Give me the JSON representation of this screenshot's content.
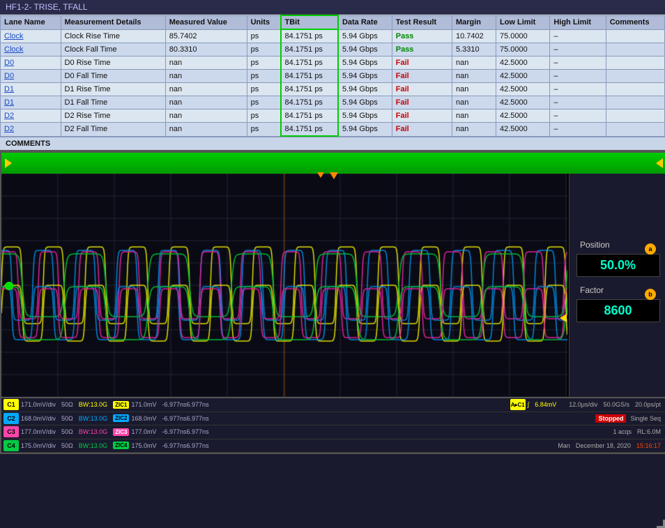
{
  "title": "HF1-2- TRISE, TFALL",
  "table": {
    "headers": [
      "Lane Name",
      "Measurement Details",
      "Measured Value",
      "Units",
      "TBit",
      "Data Rate",
      "Test Result",
      "Margin",
      "Low Limit",
      "High Limit",
      "Comments"
    ],
    "rows": [
      {
        "lane": "Clock",
        "measurement": "Clock Rise Time",
        "value": "85.7402",
        "units": "ps",
        "tbit": "84.1751 ps",
        "datarate": "5.94 Gbps",
        "result": "Pass",
        "margin": "10.7402",
        "low": "75.0000",
        "high": "–",
        "comments": ""
      },
      {
        "lane": "Clock",
        "measurement": "Clock Fall Time",
        "value": "80.3310",
        "units": "ps",
        "tbit": "84.1751 ps",
        "datarate": "5.94 Gbps",
        "result": "Pass",
        "margin": "5.3310",
        "low": "75.0000",
        "high": "–",
        "comments": ""
      },
      {
        "lane": "D0",
        "measurement": "D0 Rise Time",
        "value": "nan",
        "units": "ps",
        "tbit": "84.1751 ps",
        "datarate": "5.94 Gbps",
        "result": "Fail",
        "margin": "nan",
        "low": "42.5000",
        "high": "–",
        "comments": ""
      },
      {
        "lane": "D0",
        "measurement": "D0 Fall Time",
        "value": "nan",
        "units": "ps",
        "tbit": "84.1751 ps",
        "datarate": "5.94 Gbps",
        "result": "Fail",
        "margin": "nan",
        "low": "42.5000",
        "high": "–",
        "comments": ""
      },
      {
        "lane": "D1",
        "measurement": "D1 Rise Time",
        "value": "nan",
        "units": "ps",
        "tbit": "84.1751 ps",
        "datarate": "5.94 Gbps",
        "result": "Fail",
        "margin": "nan",
        "low": "42.5000",
        "high": "–",
        "comments": ""
      },
      {
        "lane": "D1",
        "measurement": "D1 Fall Time",
        "value": "nan",
        "units": "ps",
        "tbit": "84.1751 ps",
        "datarate": "5.94 Gbps",
        "result": "Fail",
        "margin": "nan",
        "low": "42.5000",
        "high": "–",
        "comments": ""
      },
      {
        "lane": "D2",
        "measurement": "D2 Rise Time",
        "value": "nan",
        "units": "ps",
        "tbit": "84.1751 ps",
        "datarate": "5.94 Gbps",
        "result": "Fail",
        "margin": "nan",
        "low": "42.5000",
        "high": "–",
        "comments": ""
      },
      {
        "lane": "D2",
        "measurement": "D2 Fall Time",
        "value": "nan",
        "units": "ps",
        "tbit": "84.1751 ps",
        "datarate": "5.94 Gbps",
        "result": "Fail",
        "margin": "nan",
        "low": "42.5000",
        "high": "–",
        "comments": ""
      }
    ]
  },
  "comments_label": "COMMENTS",
  "scope": {
    "position_label": "Position",
    "position_value": "50.0%",
    "factor_label": "Factor",
    "factor_value": "8600",
    "badge_a": "a",
    "badge_b": "b",
    "ch1": {
      "color": "#ffff00",
      "label": "C1",
      "vdiv": "171.0mV/div",
      "ohm": "50Ω",
      "bw": "BW:13.0G",
      "zic": "ZIC1",
      "zic_val": "171.0mV",
      "time": "-6.977ns6.977ns"
    },
    "ch2": {
      "color": "#00aaff",
      "label": "C2",
      "vdiv": "168.0mV/div",
      "ohm": "50Ω",
      "bw": "BW:13.0G",
      "zic": "ZIC2",
      "zic_val": "168.0mV",
      "time": "-6.977ns6.977ns"
    },
    "ch3": {
      "color": "#ff44aa",
      "label": "C3",
      "vdiv": "177.0mV/div",
      "ohm": "50Ω",
      "bw": "BW:13.0G",
      "zic": "ZIC3",
      "zic_val": "177.0mV",
      "time": "-6.977ns6.977ns"
    },
    "ch4": {
      "color": "#00cc44",
      "label": "C4",
      "vdiv": "175.0mV/div",
      "ohm": "50Ω",
      "bw": "BW:13.0G",
      "zic": "ZIC4",
      "zic_val": "175.0mV",
      "time": "-6.977ns6.977ns"
    },
    "timebase": "12.0μs/div",
    "sample_rate": "50.0GS/s",
    "pts": "20.0ps/pt",
    "status": "Stopped",
    "mode": "Single Seq",
    "acqs": "1 acqs",
    "rl": "RL:6.0M",
    "cursor_label": "C1",
    "cursor_icon": "∫",
    "cursor_value": "6.84mV",
    "date": "December 18, 2020",
    "time_val": "15:16:17"
  }
}
